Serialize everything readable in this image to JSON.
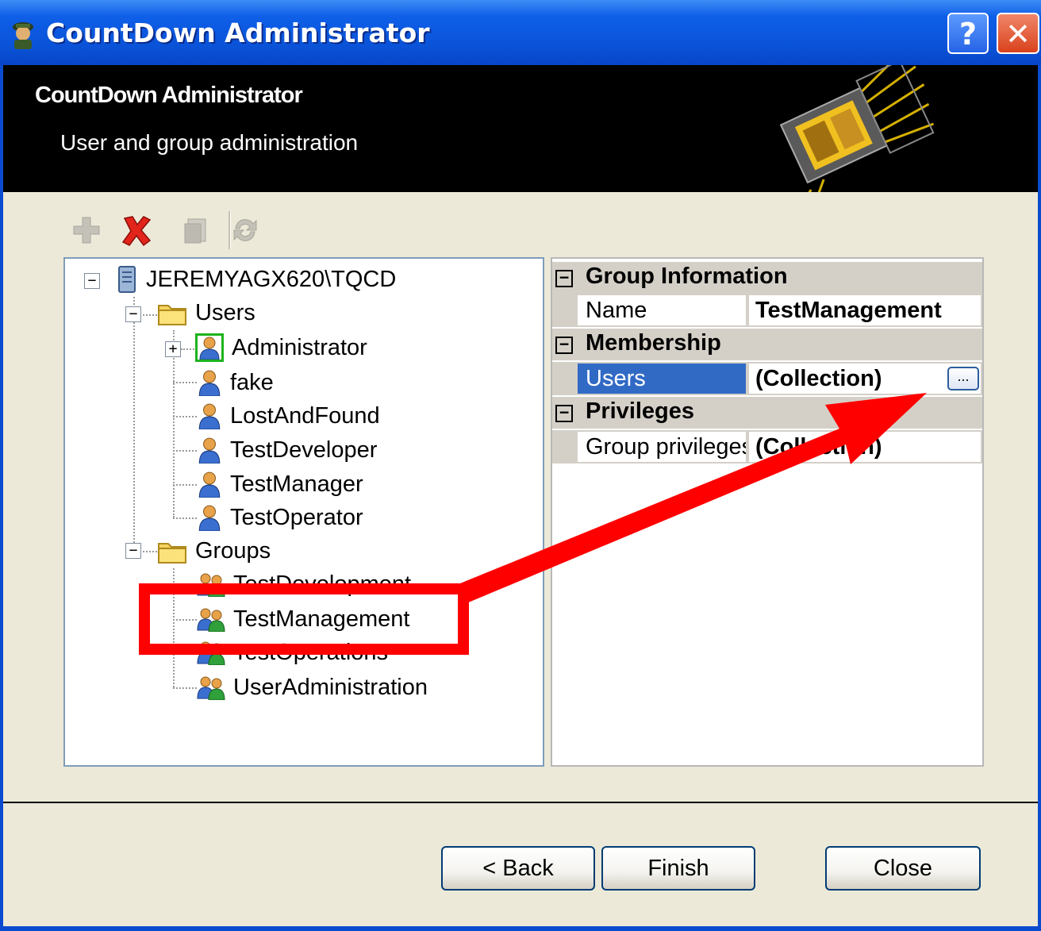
{
  "window": {
    "title": "CountDown Administrator",
    "help_glyph": "?",
    "close_glyph": "✕"
  },
  "banner": {
    "title": "CountDown Administrator",
    "subtitle": "User and group administration"
  },
  "toolbar": {
    "items": [
      {
        "icon": "add-icon",
        "enabled": false
      },
      {
        "icon": "delete-icon",
        "enabled": true
      },
      {
        "icon": "properties-icon",
        "enabled": false
      },
      {
        "icon": "refresh-icon",
        "enabled": false
      }
    ]
  },
  "tree": {
    "root": "JEREMYAGX620\\TQCD",
    "users_folder": "Users",
    "users": [
      "Administrator",
      "fake",
      "LostAndFound",
      "TestDeveloper",
      "TestManager",
      "TestOperator"
    ],
    "groups_folder": "Groups",
    "groups": [
      "TestDevelopment",
      "TestManagement",
      "TestOperations",
      "UserAdministration"
    ],
    "selected_group": "TestManagement"
  },
  "properties": {
    "cat_group_info": "Group Information",
    "name_label": "Name",
    "name_value": "TestManagement",
    "cat_membership": "Membership",
    "users_label": "Users",
    "users_value": "(Collection)",
    "ellipsis": "...",
    "cat_privileges": "Privileges",
    "privileges_label": "Group privileges",
    "privileges_value": "(Collection)",
    "toggle_glyph": "−"
  },
  "footer": {
    "back_label": "< Back",
    "finish_label": "Finish",
    "close_label": "Close"
  },
  "colors": {
    "titlebar": "#0a53d8",
    "selection": "#316ac5",
    "annotation": "#ff0000"
  }
}
